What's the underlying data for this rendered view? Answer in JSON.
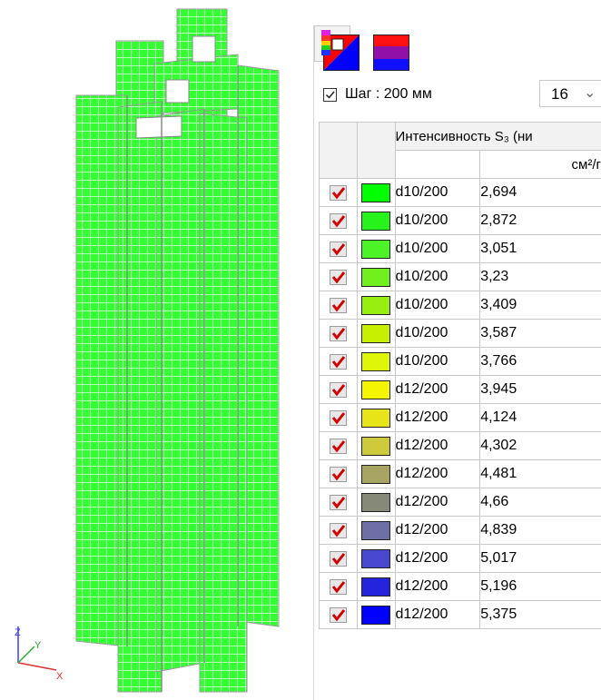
{
  "legend": {
    "step_label": "Шаг : 200 мм",
    "step_checked": true,
    "steps_count": "16",
    "header_title": "Интенсивность S₃ (ни",
    "header_unit": "см²/г",
    "rows": [
      {
        "diameter": "d10/200",
        "value": "2,694",
        "color": "#00ff00"
      },
      {
        "diameter": "d10/200",
        "value": "2,872",
        "color": "#27f21b"
      },
      {
        "diameter": "d10/200",
        "value": "3,051",
        "color": "#4cf427"
      },
      {
        "diameter": "d10/200",
        "value": "3,23",
        "color": "#72f01d"
      },
      {
        "diameter": "d10/200",
        "value": "3,409",
        "color": "#98ee10"
      },
      {
        "diameter": "d10/200",
        "value": "3,587",
        "color": "#c7f000"
      },
      {
        "diameter": "d10/200",
        "value": "3,766",
        "color": "#dff50a"
      },
      {
        "diameter": "d12/200",
        "value": "3,945",
        "color": "#f5f500"
      },
      {
        "diameter": "d12/200",
        "value": "4,124",
        "color": "#e8e41a"
      },
      {
        "diameter": "d12/200",
        "value": "4,302",
        "color": "#ccca3a"
      },
      {
        "diameter": "d12/200",
        "value": "4,481",
        "color": "#a8a463"
      },
      {
        "diameter": "d12/200",
        "value": "4,66",
        "color": "#868878"
      },
      {
        "diameter": "d12/200",
        "value": "4,839",
        "color": "#6f6fa8"
      },
      {
        "diameter": "d12/200",
        "value": "5,017",
        "color": "#4848cf"
      },
      {
        "diameter": "d12/200",
        "value": "5,196",
        "color": "#2424dd"
      },
      {
        "diameter": "d12/200",
        "value": "5,375",
        "color": "#0000ff"
      }
    ]
  },
  "axes": {
    "x": "X",
    "y": "Y",
    "z": "Z"
  },
  "colors": {
    "mesh_fill": "#33ff33",
    "mesh_line": "#b6ffb6",
    "check_mark": "#d40000"
  }
}
